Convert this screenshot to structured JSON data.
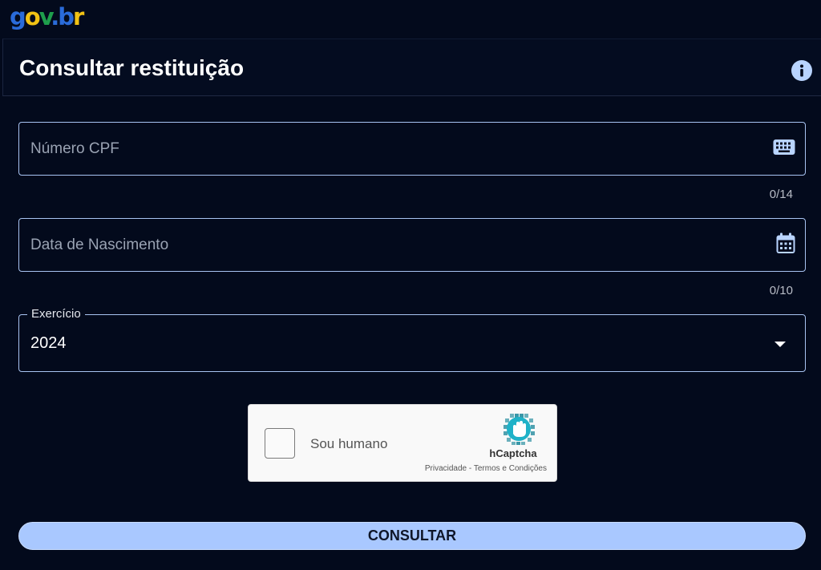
{
  "logo": {
    "g": "g",
    "o": "o",
    "v": "v",
    "dot": ".",
    "b": "b",
    "r": "r"
  },
  "header": {
    "title": "Consultar restituição"
  },
  "cpf": {
    "placeholder": "Número CPF",
    "counter": "0/14",
    "icon": "keyboard-icon"
  },
  "birth": {
    "placeholder": "Data de Nascimento",
    "counter": "0/10",
    "icon": "calendar-icon"
  },
  "exercise": {
    "label": "Exercício",
    "value": "2024"
  },
  "captcha": {
    "label": "Sou humano",
    "brand": "hCaptcha",
    "privacy": "Privacidade",
    "separator": " - ",
    "terms": "Termos e Condições"
  },
  "submit": {
    "label": "CONSULTAR"
  },
  "colors": {
    "background": "#030a1c",
    "field_border": "#a8c4f2",
    "accent": "#a9c8ff",
    "info_icon": "#b9d4ff"
  }
}
